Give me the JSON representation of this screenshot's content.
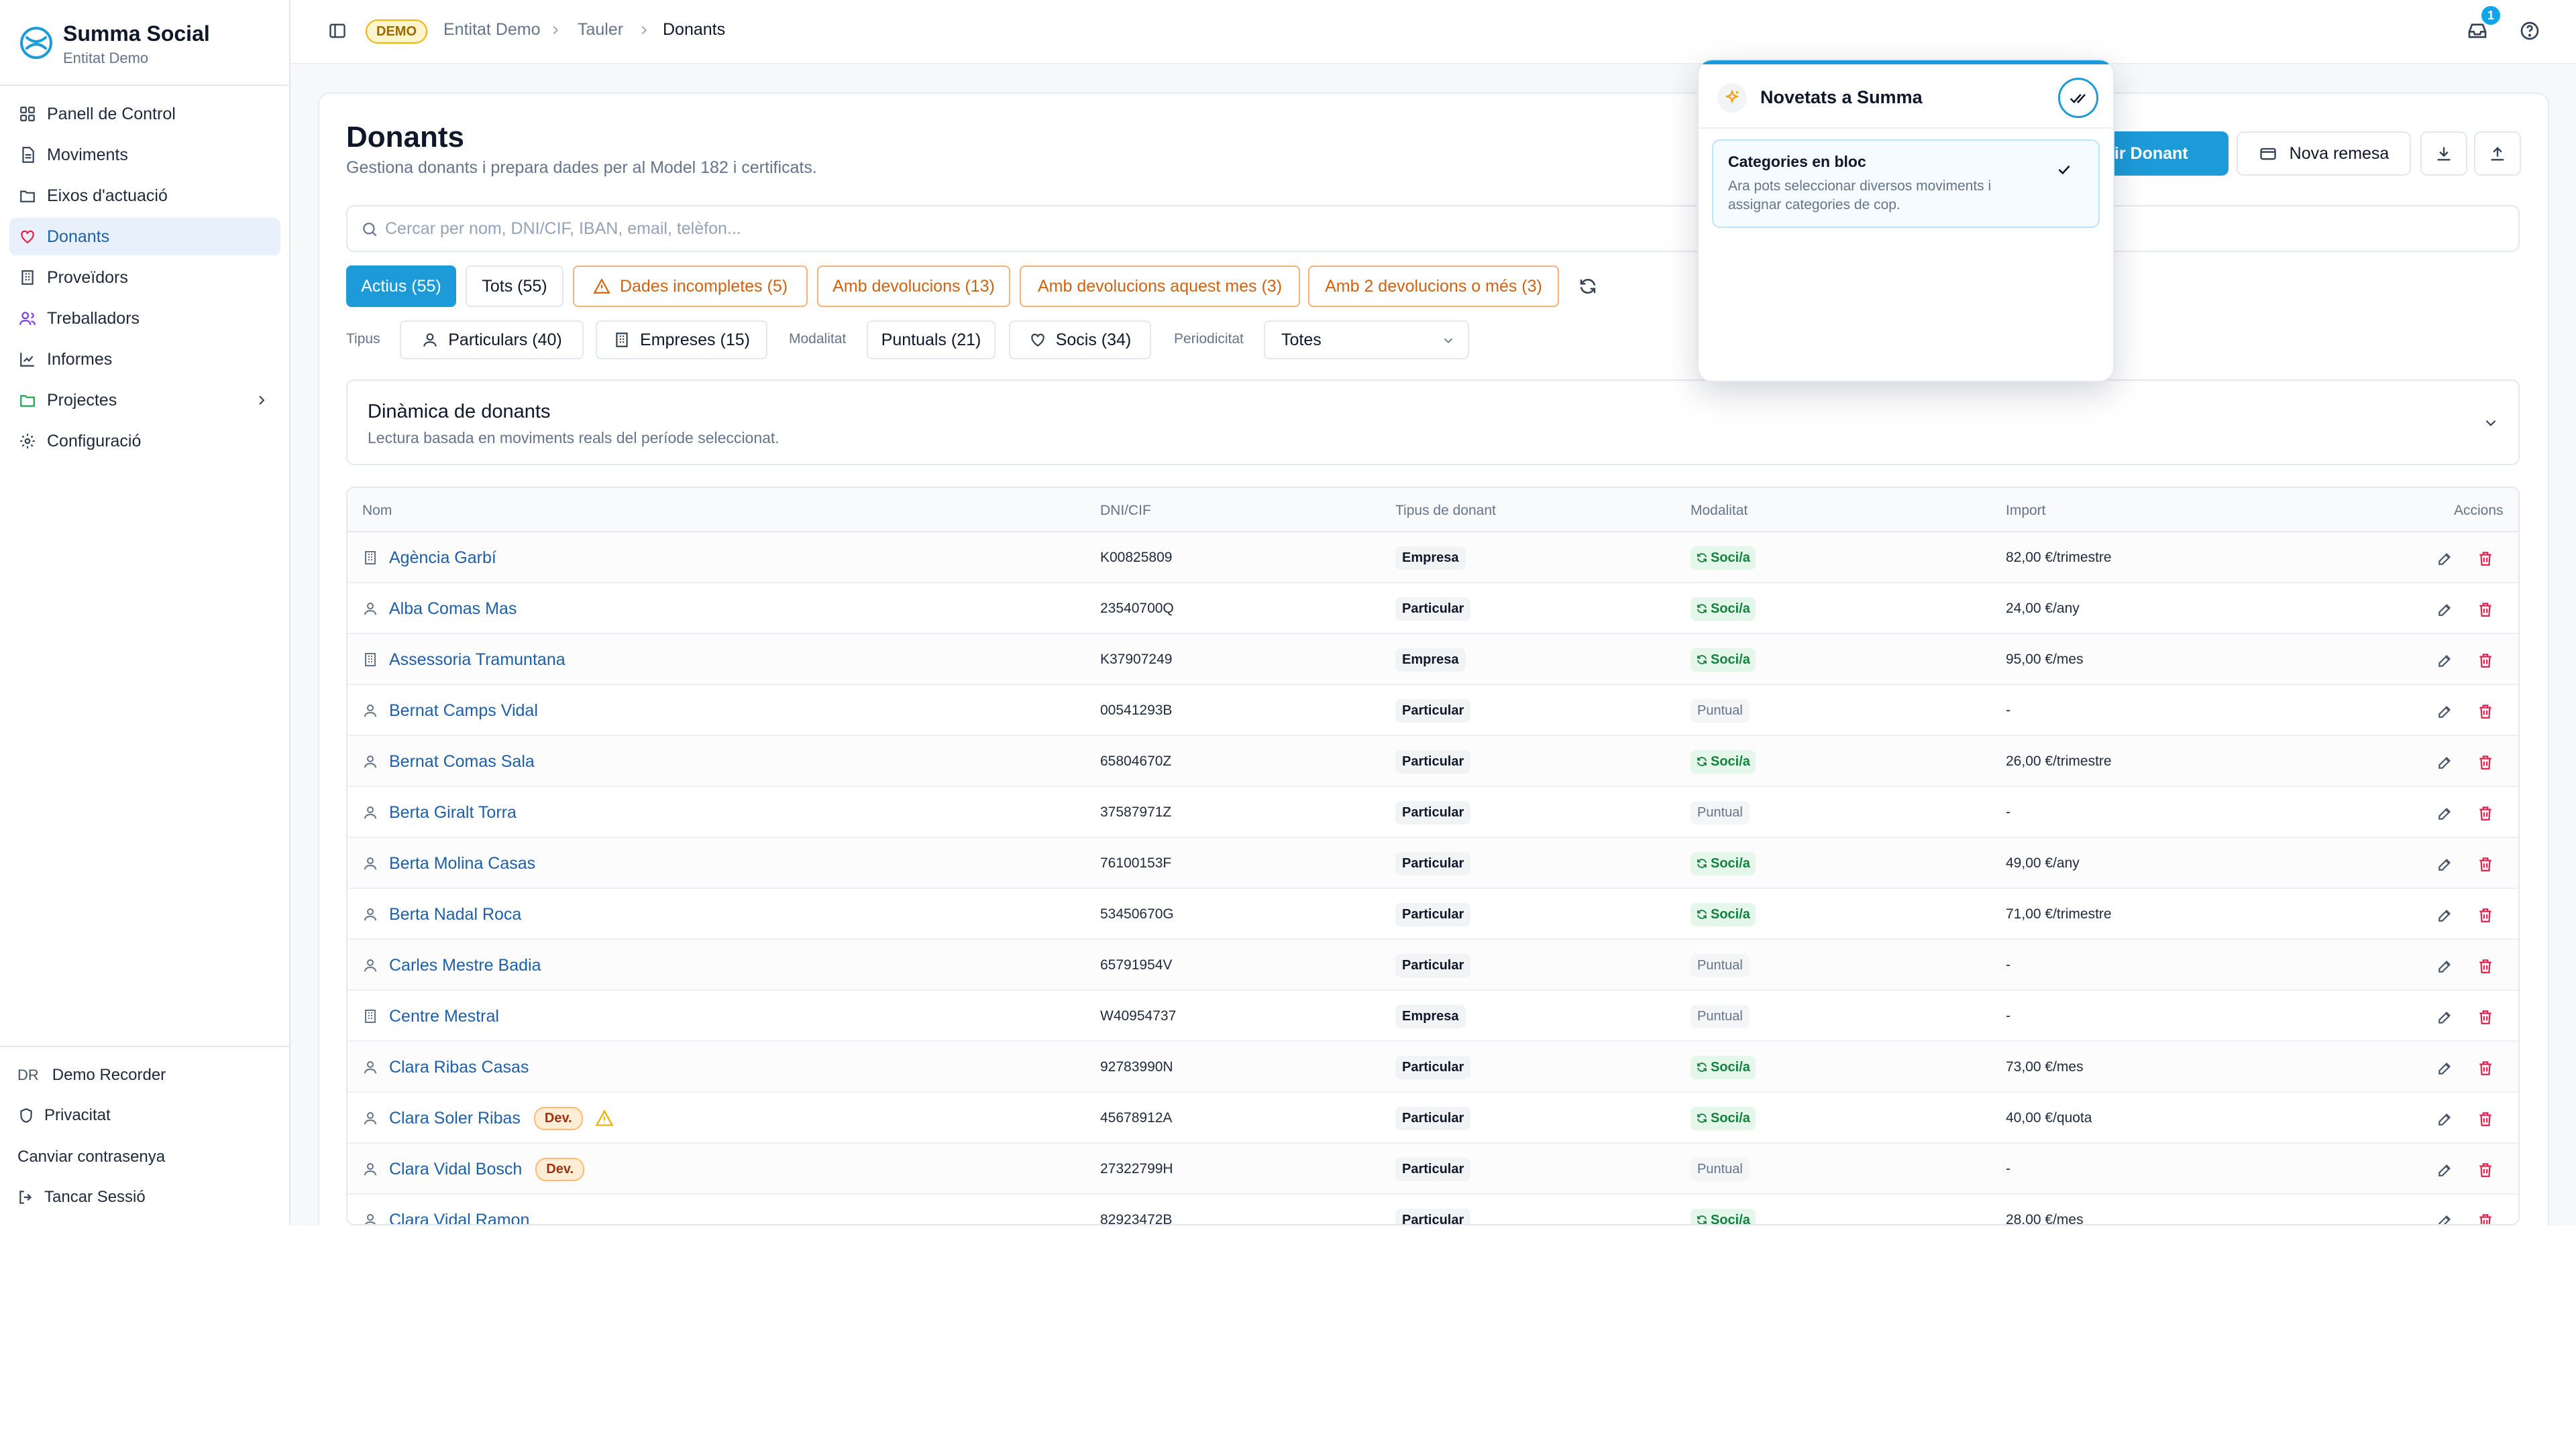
{
  "brand": {
    "title": "Summa Social",
    "subtitle": "Entitat Demo"
  },
  "sidebar": {
    "items": [
      {
        "label": "Panell de Control",
        "icon": "dashboard-icon"
      },
      {
        "label": "Moviments",
        "icon": "document-icon"
      },
      {
        "label": "Eixos d'actuació",
        "icon": "folder-icon"
      },
      {
        "label": "Donants",
        "icon": "heart-icon",
        "active": true
      },
      {
        "label": "Proveïdors",
        "icon": "building-icon"
      },
      {
        "label": "Treballadors",
        "icon": "users-icon"
      },
      {
        "label": "Informes",
        "icon": "chart-icon"
      },
      {
        "label": "Projectes",
        "icon": "folder-icon"
      },
      {
        "label": "Configuració",
        "icon": "gear-icon"
      }
    ],
    "footer": {
      "user_initials": "DR",
      "user_name": "Demo Recorder",
      "privacy": "Privacitat",
      "change_password": "Canviar contrasenya",
      "logout": "Tancar Sessió"
    }
  },
  "topbar": {
    "demo_badge": "DEMO",
    "breadcrumbs": [
      "Entitat Demo",
      "Tauler",
      "Donants"
    ],
    "notification_count": "1"
  },
  "page": {
    "title": "Donants",
    "subtitle": "Gestiona donants i prepara dades per al Model 182 i certificats.",
    "add_button": "Afegir Donant",
    "batch_button": "Nova remesa",
    "search_placeholder": "Cercar per nom, DNI/CIF, IBAN, email, telèfon..."
  },
  "filters": {
    "status_chips": [
      "Actius (55)",
      "Tots (55)",
      "Dades incompletes (5)",
      "Amb devolucions (13)",
      "Amb devolucions aquest mes (3)",
      "Amb 2 devolucions o més (3)"
    ],
    "type_label": "Tipus",
    "types": [
      "Particulars (40)",
      "Empreses (15)"
    ],
    "mode_label": "Modalitat",
    "modes": [
      "Puntuals (21)",
      "Socis (34)"
    ],
    "period_label": "Periodicitat",
    "period_value": "Totes"
  },
  "dynamics": {
    "title": "Dinàmica de donants",
    "subtitle": "Lectura basada en moviments reals del període seleccionat."
  },
  "table": {
    "columns": [
      "Nom",
      "DNI/CIF",
      "Tipus de donant",
      "Modalitat",
      "Import",
      "Accions"
    ],
    "rows": [
      {
        "name": "Agència Garbí",
        "kind": "company",
        "dni": "K00825809",
        "type": "Empresa",
        "mode": "Soci/a",
        "amount": "82,00 €/trimestre"
      },
      {
        "name": "Alba Comas Mas",
        "kind": "person",
        "dni": "23540700Q",
        "type": "Particular",
        "mode": "Soci/a",
        "amount": "24,00 €/any"
      },
      {
        "name": "Assessoria Tramuntana",
        "kind": "company",
        "dni": "K37907249",
        "type": "Empresa",
        "mode": "Soci/a",
        "amount": "95,00 €/mes"
      },
      {
        "name": "Bernat Camps Vidal",
        "kind": "person",
        "dni": "00541293B",
        "type": "Particular",
        "mode": "Puntual",
        "amount": "-"
      },
      {
        "name": "Bernat Comas Sala",
        "kind": "person",
        "dni": "65804670Z",
        "type": "Particular",
        "mode": "Soci/a",
        "amount": "26,00 €/trimestre"
      },
      {
        "name": "Berta Giralt Torra",
        "kind": "person",
        "dni": "37587971Z",
        "type": "Particular",
        "mode": "Puntual",
        "amount": "-"
      },
      {
        "name": "Berta Molina Casas",
        "kind": "person",
        "dni": "76100153F",
        "type": "Particular",
        "mode": "Soci/a",
        "amount": "49,00 €/any"
      },
      {
        "name": "Berta Nadal Roca",
        "kind": "person",
        "dni": "53450670G",
        "type": "Particular",
        "mode": "Soci/a",
        "amount": "71,00 €/trimestre"
      },
      {
        "name": "Carles Mestre Badia",
        "kind": "person",
        "dni": "65791954V",
        "type": "Particular",
        "mode": "Puntual",
        "amount": "-"
      },
      {
        "name": "Centre Mestral",
        "kind": "company",
        "dni": "W40954737",
        "type": "Empresa",
        "mode": "Puntual",
        "amount": "-"
      },
      {
        "name": "Clara Ribas Casas",
        "kind": "person",
        "dni": "92783990N",
        "type": "Particular",
        "mode": "Soci/a",
        "amount": "73,00 €/mes"
      },
      {
        "name": "Clara Soler Ribas",
        "kind": "person",
        "dni": "45678912A",
        "type": "Particular",
        "mode": "Soci/a",
        "amount": "40,00 €/quota",
        "dev": "Dev.",
        "warning": true
      },
      {
        "name": "Clara Vidal Bosch",
        "kind": "person",
        "dni": "27322799H",
        "type": "Particular",
        "mode": "Puntual",
        "amount": "-",
        "dev": "Dev."
      },
      {
        "name": "Clara Vidal Ramon",
        "kind": "person",
        "dni": "82923472B",
        "type": "Particular",
        "mode": "Soci/a",
        "amount": "28,00 €/mes"
      }
    ]
  },
  "popover": {
    "title": "Novetats a Summa",
    "item_title": "Categories en bloc",
    "item_desc": "Ara pots seleccionar diversos moviments i assignar categories de cop."
  },
  "colors": {
    "accent": "#1d9bd8",
    "link": "#1d5fa8",
    "danger": "#e11d48",
    "warning": "#d1620f",
    "success": "#15803d"
  }
}
